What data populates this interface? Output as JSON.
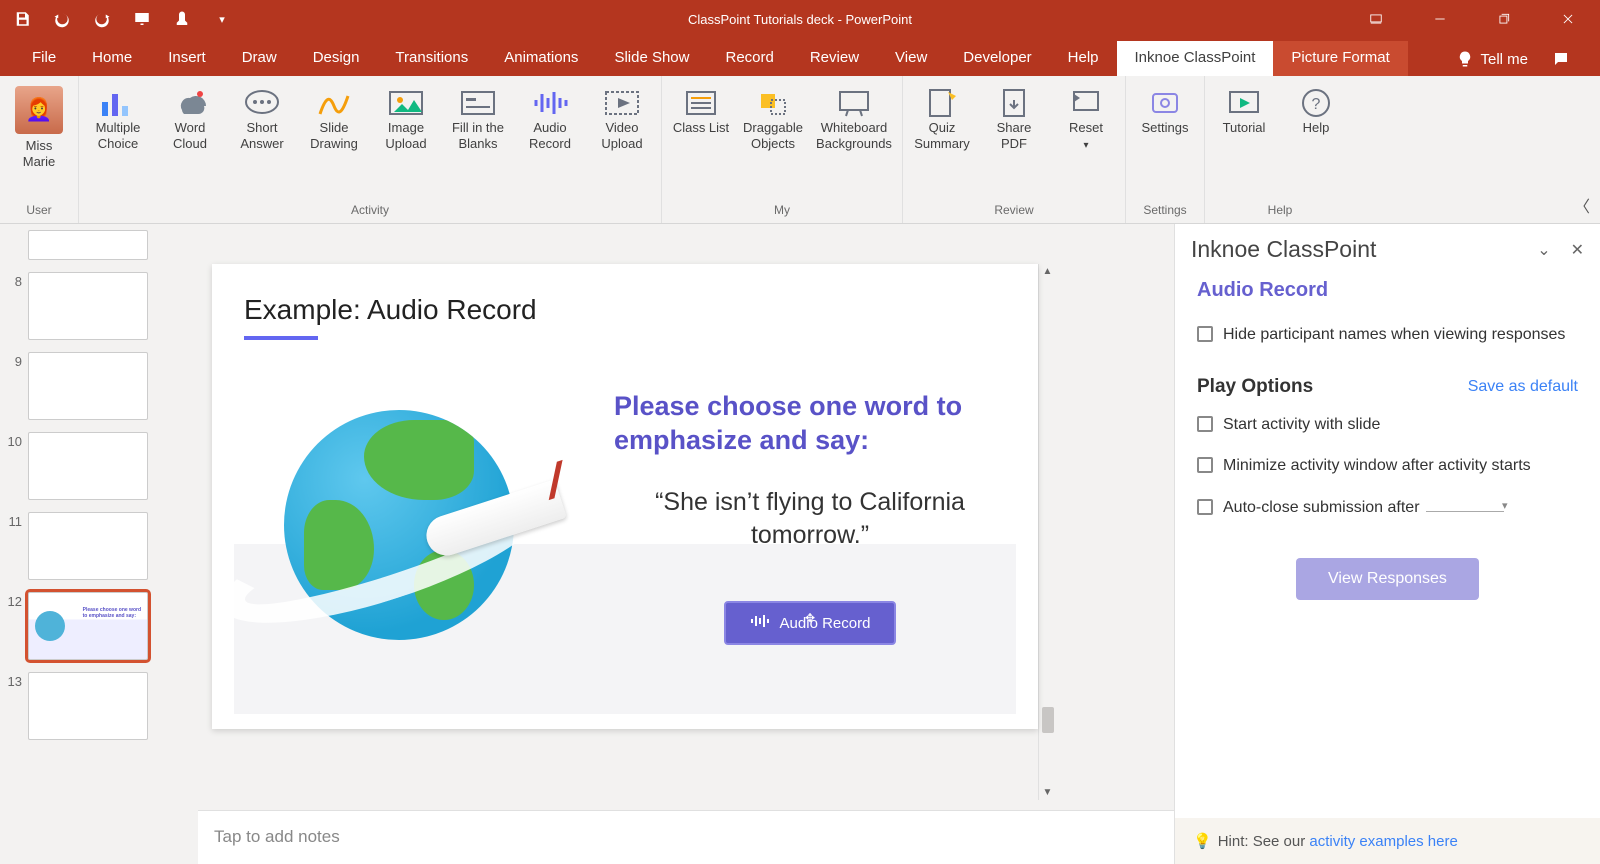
{
  "title": "ClassPoint Tutorials deck  -  PowerPoint",
  "tabs": [
    "File",
    "Home",
    "Insert",
    "Draw",
    "Design",
    "Transitions",
    "Animations",
    "Slide Show",
    "Record",
    "Review",
    "View",
    "Developer",
    "Help",
    "Inknoe ClassPoint",
    "Picture Format"
  ],
  "active_tab": "Inknoe ClassPoint",
  "tellme": "Tell me",
  "ribbon": {
    "user": {
      "name": "Miss Marie",
      "group": "User"
    },
    "activity": {
      "group": "Activity",
      "items": [
        "Multiple Choice",
        "Word Cloud",
        "Short Answer",
        "Slide Drawing",
        "Image Upload",
        "Fill in the Blanks",
        "Audio Record",
        "Video Upload"
      ]
    },
    "my": {
      "group": "My",
      "items": [
        "Class List",
        "Draggable Objects",
        "Whiteboard Backgrounds"
      ]
    },
    "review": {
      "group": "Review",
      "items": [
        "Quiz Summary",
        "Share PDF",
        "Reset"
      ]
    },
    "settings": {
      "group": "Settings",
      "items": [
        "Settings"
      ]
    },
    "help": {
      "group": "Help",
      "items": [
        "Tutorial",
        "Help"
      ]
    }
  },
  "thumbs": [
    {
      "num": "",
      "sel": false,
      "first": true
    },
    {
      "num": "8",
      "sel": false
    },
    {
      "num": "9",
      "sel": false
    },
    {
      "num": "10",
      "sel": false
    },
    {
      "num": "11",
      "sel": false
    },
    {
      "num": "12",
      "sel": true
    },
    {
      "num": "13",
      "sel": false
    }
  ],
  "slide": {
    "title": "Example: Audio Record",
    "heading": "Please choose one word to emphasize and say:",
    "quote": "“She isn’t flying to California tomorrow.”",
    "button": "Audio Record"
  },
  "notes_placeholder": "Tap to add notes",
  "pane": {
    "title": "Inknoe ClassPoint",
    "subtitle": "Audio Record",
    "opt_hide": "Hide participant names when viewing responses",
    "play_options": "Play Options",
    "save_default": "Save as default",
    "opt_start": "Start activity with slide",
    "opt_min": "Minimize activity window after activity starts",
    "opt_auto": "Auto-close submission after",
    "view_responses": "View Responses",
    "hint_prefix": "Hint: See our ",
    "hint_link": "activity examples here"
  }
}
